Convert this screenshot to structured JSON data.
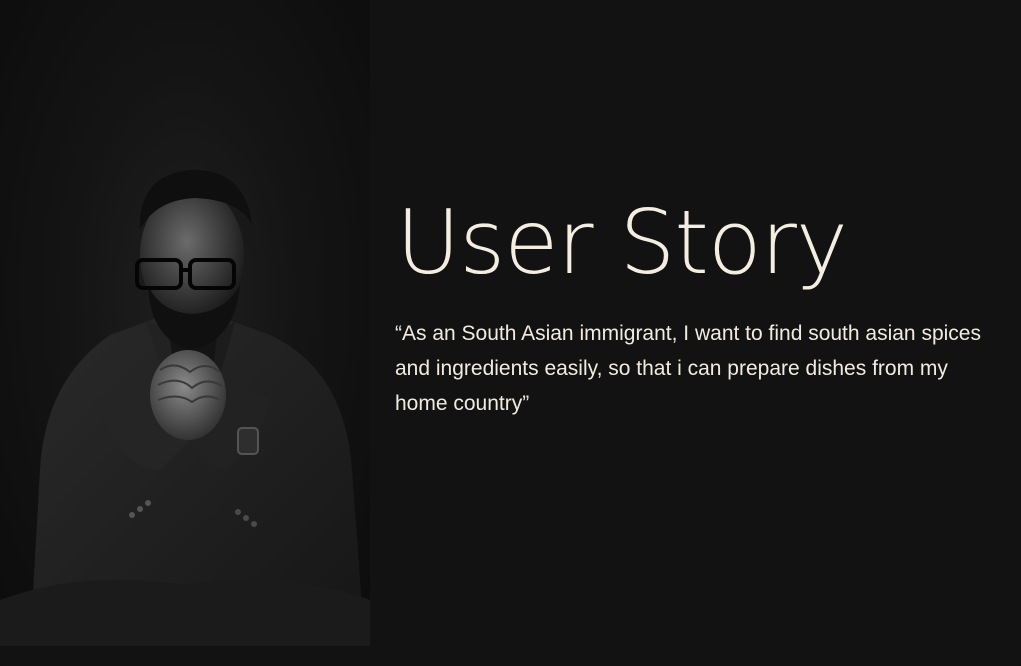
{
  "slide": {
    "title": "User Story",
    "quote": "“As an South Asian immigrant,  I want to find south asian spices and ingredients easily, so that i can prepare dishes from my home country”"
  },
  "colors": {
    "background": "#121212",
    "text": "#f4eee2"
  }
}
